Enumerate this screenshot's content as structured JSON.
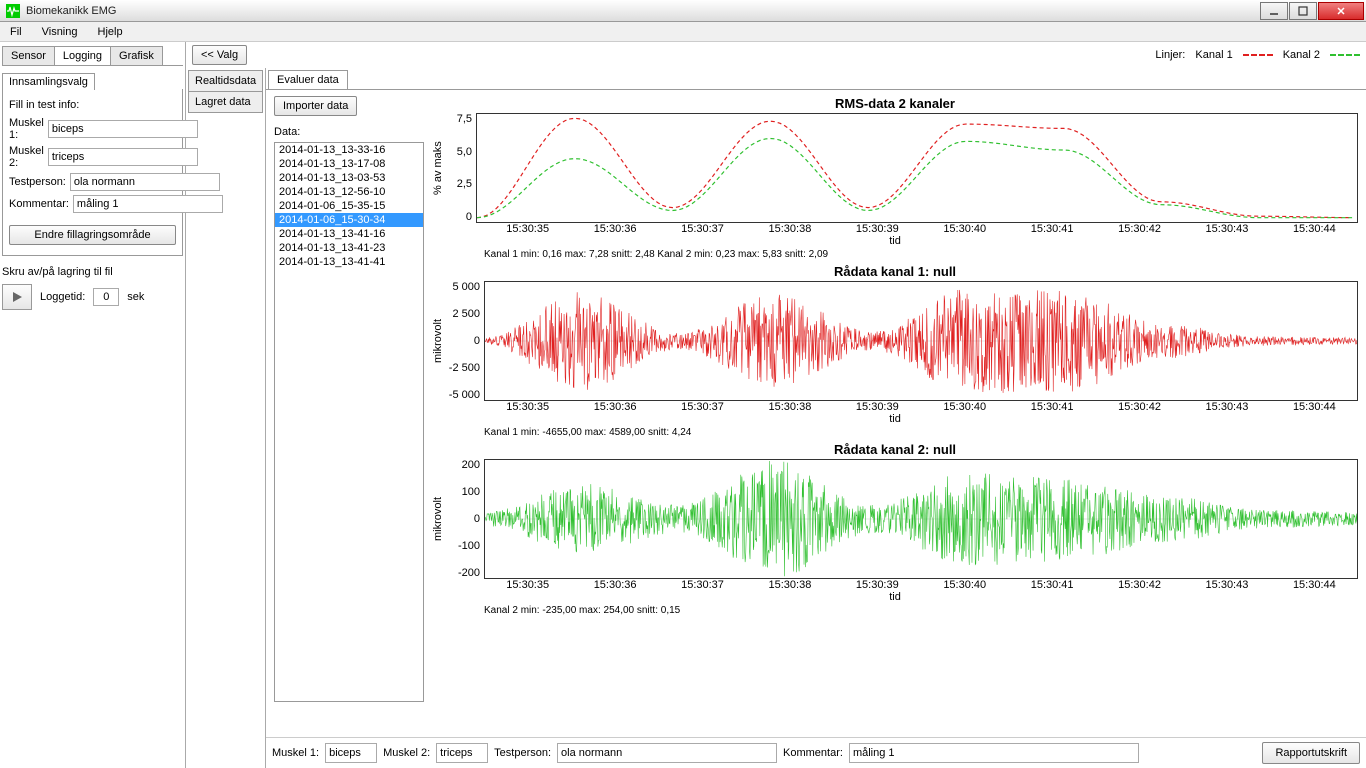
{
  "window": {
    "title": "Biomekanikk EMG"
  },
  "menu": {
    "fil": "Fil",
    "visning": "Visning",
    "hjelp": "Hjelp"
  },
  "leftTabs": {
    "sensor": "Sensor",
    "logging": "Logging",
    "grafisk": "Grafisk"
  },
  "sidebar": {
    "innsamlingsvalg": "Innsamlingsvalg",
    "fill_test_info": "Fill in test info:",
    "muskel1_label": "Muskel 1:",
    "muskel1_value": "biceps",
    "muskel2_label": "Muskel 2:",
    "muskel2_value": "triceps",
    "testperson_label": "Testperson:",
    "testperson_value": "ola normann",
    "kommentar_label": "Kommentar:",
    "kommentar_value": "måling 1",
    "endre_btn": "Endre fillagringsområde",
    "skru_label": "Skru av/på lagring til fil",
    "loggetid_label": "Loggetid:",
    "loggetid_value": "0",
    "loggetid_unit": "sek"
  },
  "topbar": {
    "valg_btn": "<< Valg",
    "legend_label": "Linjer:",
    "kanal1": "Kanal 1",
    "kanal2": "Kanal 2"
  },
  "midTabs": {
    "realtid": "Realtidsdata",
    "lagret": "Lagret data"
  },
  "rightTab": "Evaluer data",
  "importer_btn": "Importer data",
  "data_label": "Data:",
  "data_items": [
    "2014-01-13_13-33-16",
    "2014-01-13_13-17-08",
    "2014-01-13_13-03-53",
    "2014-01-13_12-56-10",
    "2014-01-06_15-35-15",
    "2014-01-06_15-30-34",
    "2014-01-13_13-41-16",
    "2014-01-13_13-41-23",
    "2014-01-13_13-41-41"
  ],
  "data_selected": 5,
  "xticks": [
    "15:30:35",
    "15:30:36",
    "15:30:37",
    "15:30:38",
    "15:30:39",
    "15:30:40",
    "15:30:41",
    "15:30:42",
    "15:30:43",
    "15:30:44"
  ],
  "xlabel": "tid",
  "chart1": {
    "title": "RMS-data 2 kanaler",
    "ylabel": "% av maks",
    "yticks": [
      "7,5",
      "5,0",
      "2,5",
      "0"
    ],
    "stats": "Kanal 1    min:    0,16    max:    7,28    snitt:    2,48    Kanal 2    min:    0,23    max:    5,83    snitt:    2,09"
  },
  "chart2": {
    "title": "Rådata kanal 1: null",
    "ylabel": "mikrovolt",
    "yticks": [
      "5 000",
      "2 500",
      "0",
      "-2 500",
      "-5 000"
    ],
    "stats": "Kanal 1    min:    -4655,00    max:    4589,00    snitt:    4,24"
  },
  "chart3": {
    "title": "Rådata kanal 2: null",
    "ylabel": "mikrovolt",
    "yticks": [
      "200",
      "100",
      "0",
      "-100",
      "-200"
    ],
    "stats": "Kanal 2    min:    -235,00    max:    254,00    snitt:    0,15"
  },
  "bottom": {
    "muskel1_label": "Muskel 1:",
    "muskel1_value": "biceps",
    "muskel2_label": "Muskel 2:",
    "muskel2_value": "triceps",
    "testperson_label": "Testperson:",
    "testperson_value": "ola normann",
    "kommentar_label": "Kommentar:",
    "kommentar_value": "måling 1",
    "rapport_btn": "Rapportutskrift"
  },
  "chart_data": [
    {
      "type": "line",
      "title": "RMS-data 2 kanaler",
      "xlabel": "tid",
      "ylabel": "% av maks",
      "ylim": [
        0,
        7.5
      ],
      "x": [
        "15:30:35",
        "15:30:36",
        "15:30:37",
        "15:30:38",
        "15:30:39",
        "15:30:40",
        "15:30:41",
        "15:30:42",
        "15:30:43",
        "15:30:44"
      ],
      "series": [
        {
          "name": "Kanal 1",
          "color": "#e02020",
          "values_at_ticks": [
            0.3,
            7.2,
            1.0,
            7.0,
            1.0,
            6.8,
            6.5,
            1.4,
            0.4,
            0.3
          ]
        },
        {
          "name": "Kanal 2",
          "color": "#30c030",
          "values_at_ticks": [
            0.3,
            4.4,
            0.8,
            5.8,
            0.8,
            5.6,
            5.0,
            1.2,
            0.3,
            0.3
          ]
        }
      ],
      "stats": {
        "kanal1": {
          "min": 0.16,
          "max": 7.28,
          "mean": 2.48
        },
        "kanal2": {
          "min": 0.23,
          "max": 5.83,
          "mean": 2.09
        }
      }
    },
    {
      "type": "line",
      "title": "Rådata kanal 1: null",
      "xlabel": "tid",
      "ylabel": "mikrovolt",
      "ylim": [
        -5000,
        5000
      ],
      "color": "#e02020",
      "envelope_at_ticks": [
        300,
        4200,
        700,
        4000,
        800,
        4500,
        4300,
        1500,
        400,
        300
      ],
      "stats": {
        "min": -4655.0,
        "max": 4589.0,
        "mean": 4.24
      }
    },
    {
      "type": "line",
      "title": "Rådata kanal 2: null",
      "xlabel": "tid",
      "ylabel": "mikrovolt",
      "ylim": [
        -250,
        250
      ],
      "color": "#30c030",
      "envelope_at_ticks": [
        30,
        150,
        60,
        250,
        60,
        200,
        180,
        100,
        40,
        30
      ],
      "stats": {
        "min": -235.0,
        "max": 254.0,
        "mean": 0.15
      }
    }
  ]
}
